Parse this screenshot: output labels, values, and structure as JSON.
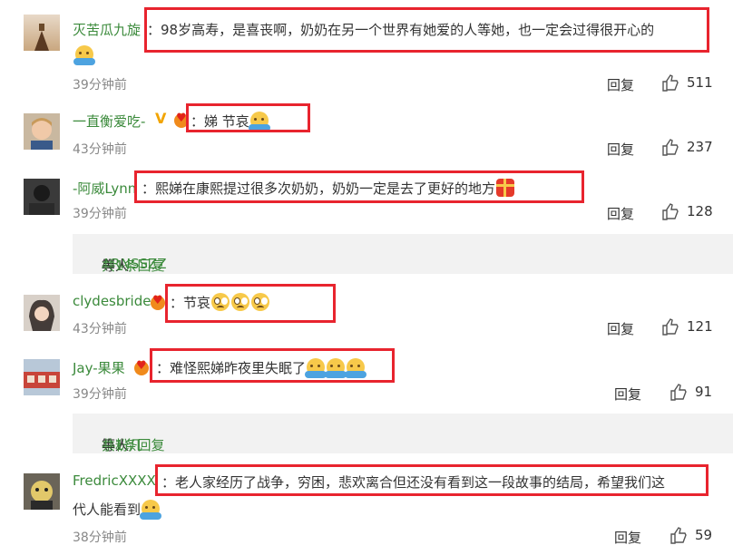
{
  "comments": [
    {
      "user": "灭苦瓜九旋",
      "text_a": "：98岁高寿，是喜丧啊，奶奶在另一个世界有她爱的人等她，也一定会过得很开心的",
      "time": "39分钟前",
      "reply": "回复",
      "likes": "511"
    },
    {
      "user": "一直衡爱吃-",
      "text_a": "：娣 节哀",
      "time": "43分钟前",
      "reply": "回复",
      "likes": "237"
    },
    {
      "user": "-阿威Lynn",
      "text_a": "：熙娣在康熙提过很多次奶奶，奶奶一定是去了更好的地方",
      "time": "39分钟前",
      "reply": "回复",
      "likes": "128"
    },
    {
      "user": "clydesbride",
      "text_a": "：节哀",
      "time": "43分钟前",
      "reply": "回复",
      "likes": "121"
    },
    {
      "user": "Jay-果果",
      "text_a": "：难怪熙娣昨夜里失眠了",
      "time": "39分钟前",
      "reply": "回复",
      "likes": "91"
    },
    {
      "user": "FredricXXXX",
      "text_a": "：老人家经历了战争，穷困，悲欢离合但还没有看到这一段故事的结局，希望我们这",
      "text_b": "代人能看到",
      "time": "38分钟前",
      "reply": "回复",
      "likes": "59"
    }
  ],
  "subreplies": [
    {
      "user": "ARNSSZZ",
      "mid": " 等人 ",
      "count": "共1条回复"
    },
    {
      "user": "小粉几",
      "mid": " 等人 ",
      "count": "共1条回复"
    }
  ],
  "colors": {
    "username": "#3b8a3b",
    "highlight": "#e8242e",
    "subreply_bg": "#f2f2f2"
  }
}
